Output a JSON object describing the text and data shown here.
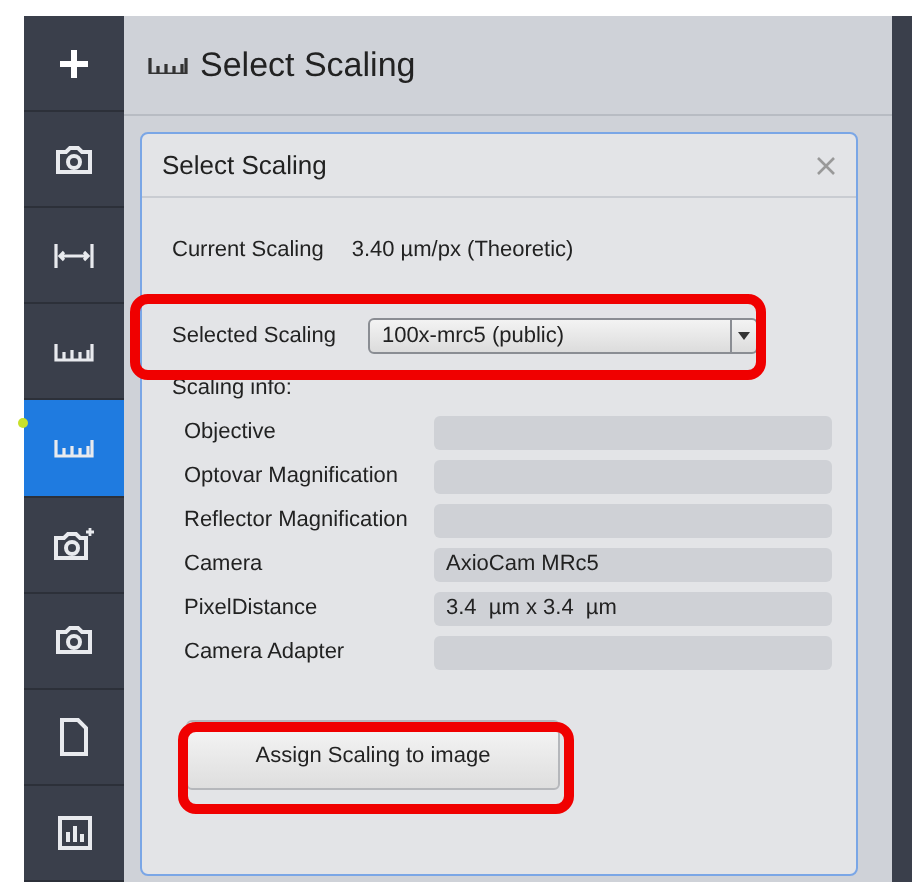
{
  "sidebar": {
    "items": [
      {
        "kind": "add",
        "selected": false
      },
      {
        "kind": "camera",
        "selected": false
      },
      {
        "kind": "measure",
        "selected": false
      },
      {
        "kind": "ruler",
        "selected": false
      },
      {
        "kind": "ruler",
        "selected": true
      },
      {
        "kind": "camera-settings",
        "selected": false
      },
      {
        "kind": "camera",
        "selected": false
      },
      {
        "kind": "document",
        "selected": false
      },
      {
        "kind": "chart",
        "selected": false
      }
    ]
  },
  "header": {
    "title": "Select Scaling"
  },
  "dialog": {
    "title": "Select Scaling",
    "current_scaling": {
      "label": "Current Scaling",
      "value": "3.40 µm/px (Theoretic)"
    },
    "selected_scaling": {
      "label": "Selected Scaling",
      "value": "100x-mrc5 (public)",
      "highlighted": true
    },
    "info_heading": "Scaling info:",
    "info_rows": [
      {
        "label": "Objective",
        "value": ""
      },
      {
        "label": "Optovar Magnification",
        "value": ""
      },
      {
        "label": "Reflector Magnification",
        "value": ""
      },
      {
        "label": "Camera",
        "value": "AxioCam MRc5"
      },
      {
        "label": "PixelDistance",
        "value": "3.4  µm x 3.4  µm"
      },
      {
        "label": "Camera Adapter",
        "value": ""
      }
    ],
    "assign_button": {
      "label": "Assign Scaling to image",
      "highlighted": true
    }
  }
}
